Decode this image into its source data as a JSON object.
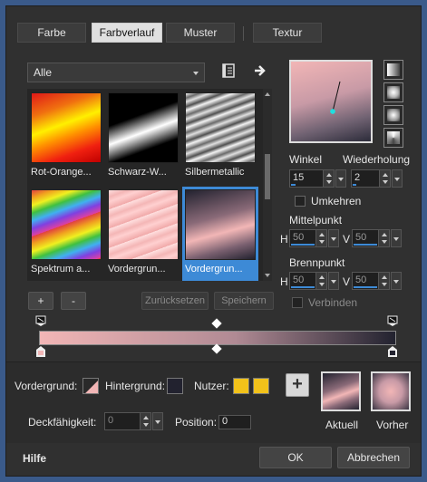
{
  "tabs": [
    {
      "label": "Farbe",
      "active": false
    },
    {
      "label": "Farbverlauf",
      "active": true
    },
    {
      "label": "Muster",
      "active": false
    },
    {
      "label": "Textur",
      "active": false
    }
  ],
  "category": {
    "selected": "Alle"
  },
  "gradients": [
    {
      "label": "Rot-Orange...",
      "selected": false
    },
    {
      "label": "Schwarz-W...",
      "selected": false
    },
    {
      "label": "Silbermetallic",
      "selected": false
    },
    {
      "label": "Spektrum a...",
      "selected": false
    },
    {
      "label": "Vordergrun...",
      "selected": false
    },
    {
      "label": "Vordergrun...",
      "selected": true
    }
  ],
  "list_buttons": {
    "add": "+",
    "remove": "-",
    "reset": "Zurücksetzen",
    "save": "Speichern"
  },
  "angle": {
    "label": "Winkel",
    "value": "15"
  },
  "repeat": {
    "label": "Wiederholung",
    "value": "2"
  },
  "invert": {
    "label": "Umkehren",
    "checked": false
  },
  "center": {
    "label": "Mittelpunkt",
    "h_label": "H",
    "h_value": "50",
    "v_label": "V",
    "v_value": "50"
  },
  "focus": {
    "label": "Brennpunkt",
    "h_label": "H",
    "h_value": "50",
    "v_label": "V",
    "v_value": "50"
  },
  "link": {
    "label": "Verbinden",
    "checked": false
  },
  "foreground_label": "Vordergrund:",
  "background_label": "Hintergrund:",
  "user_label": "Nutzer:",
  "opacity": {
    "label": "Deckfähigkeit:",
    "value": "0"
  },
  "position": {
    "label": "Position:",
    "value": "0"
  },
  "add_stop": "+",
  "current_label": "Aktuell",
  "previous_label": "Vorher",
  "help": "Hilfe",
  "ok": "OK",
  "cancel": "Abbrechen",
  "colors": {
    "gradient_start": "#f2b6b6",
    "gradient_end": "#22222f",
    "user": "#f2c21a",
    "accent": "#3d8ad6"
  }
}
